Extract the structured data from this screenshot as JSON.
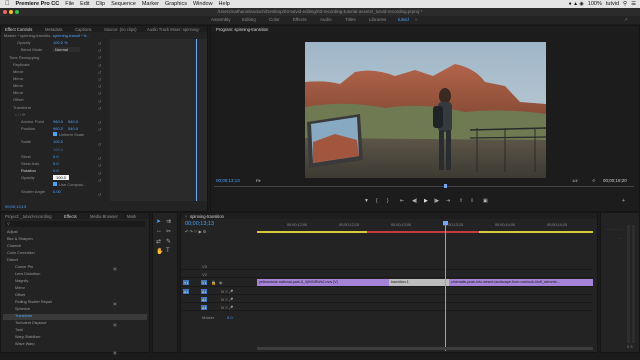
{
  "menubar": {
    "app": "Premiere Pro CC",
    "items": [
      "File",
      "Edit",
      "Clip",
      "Sequence",
      "Marker",
      "Graphics",
      "Window",
      "Help"
    ],
    "user": "tutvid",
    "battery": "100%"
  },
  "titlebar": {
    "path": "/Users/nathanielandoch/Desktop/03-tutvid-editing/03-recording-tutorial-assets/_tutvid-recording.prproj *"
  },
  "workspaces": {
    "items": [
      "Assembly",
      "Editing",
      "Color",
      "Effects",
      "Audio",
      "Titles",
      "Libraries",
      "tutvid"
    ],
    "active": "tutvid"
  },
  "effect_controls": {
    "tabs": [
      "Effect Controls",
      "Metadata",
      "Captions",
      "Source: (no clips)",
      "Audio Track Mixer: spinning-"
    ],
    "source": "Master * spinning-transitio...",
    "seq_clip": "spinning-transit * fr...",
    "rows": [
      {
        "label": "Opacity",
        "value": "100.0 %",
        "indent": 1
      },
      {
        "label": "Blend Mode",
        "value": "Normal",
        "indent": 1
      },
      {
        "label": "Time Remapping",
        "value": "",
        "indent": 0
      },
      {
        "label": "Replicate",
        "value": "",
        "indent": 0
      },
      {
        "label": "Mirror",
        "value": "",
        "indent": 0
      },
      {
        "label": "Mirror",
        "value": "",
        "indent": 0
      },
      {
        "label": "Mirror",
        "value": "",
        "indent": 0
      },
      {
        "label": "Mirror",
        "value": "",
        "indent": 0
      },
      {
        "label": "Offset",
        "value": "",
        "indent": 0
      },
      {
        "label": "Transform",
        "value": "",
        "indent": 0
      }
    ],
    "transform": {
      "anchor_label": "Anchor Point",
      "anchor_x": "960.0",
      "anchor_y": "540.0",
      "position_label": "Position",
      "position_x": "960.0",
      "position_y": "540.0",
      "uniform_label": "Uniform Scale",
      "scale_label": "Scale",
      "scale_value": "100.0",
      "scale_w_value": "100.0",
      "skew_label": "Skew",
      "skew_value": "0.0",
      "skew_axis_label": "Skew Axis",
      "skew_axis_value": "0.0",
      "rotation_label": "Rotation",
      "rotation_value": "0.0",
      "opacity_label": "Opacity",
      "opacity_value": "100.0",
      "use_comp_label": "Use Composi...",
      "shutter_label": "Shutter Angle",
      "shutter_value": "0.00"
    },
    "timecode": "00;00;13;13"
  },
  "program": {
    "title": "Program: spinning-transition",
    "timecode": "00;00;13;13",
    "fit": "Fit",
    "quality": "1/4",
    "duration": "00;00;19;20"
  },
  "project": {
    "tabs": [
      "Project: _tutvid-recording",
      "Effects",
      "Media Browser",
      "Mark"
    ],
    "effects": [
      {
        "label": "Adjust",
        "sel": false
      },
      {
        "label": "Blur & Sharpen",
        "sel": false
      },
      {
        "label": "Channel",
        "sel": false
      },
      {
        "label": "Color Correction",
        "sel": false
      },
      {
        "label": "Distort",
        "sel": false
      },
      {
        "label": "Corner Pin",
        "sel": false
      },
      {
        "label": "Lens Distortion",
        "sel": false
      },
      {
        "label": "Magnify",
        "sel": false
      },
      {
        "label": "Mirror",
        "sel": false
      },
      {
        "label": "Offset",
        "sel": false
      },
      {
        "label": "Rolling Shutter Repair",
        "sel": false
      },
      {
        "label": "Spherize",
        "sel": false
      },
      {
        "label": "Transform",
        "sel": true
      },
      {
        "label": "Turbulent Displace",
        "sel": false
      },
      {
        "label": "Twirl",
        "sel": false
      },
      {
        "label": "Warp Stabilizer",
        "sel": false
      },
      {
        "label": "Wave Warp",
        "sel": false
      }
    ]
  },
  "timeline": {
    "tab": "spinning-transition",
    "timecode": "00;00;13;13",
    "ruler": [
      "00;00;12;00",
      "00;00;12;15",
      "00;00;13;00",
      "00;00;13;15",
      "00;00;14;00",
      "00;00;14;15"
    ],
    "video_tracks": [
      "V3",
      "V2",
      "V1"
    ],
    "audio_tracks": [
      "A1",
      "A2",
      "A3"
    ],
    "master_label": "Master",
    "master_value": "0.0",
    "clips": [
      {
        "label": "yellowstone-national-park-8_9j9VNRWs2.mov [V]",
        "kind": "clip"
      },
      {
        "label": "transition-1",
        "kind": "transition"
      },
      {
        "label": "cinematic-push-into-desert-landscape-from-overlook-bluff_slemmb...",
        "kind": "clip"
      }
    ]
  },
  "colors": {
    "accent": "#4aa3ff",
    "clip": "#a583d6",
    "playhead": "#6ea8ff"
  }
}
